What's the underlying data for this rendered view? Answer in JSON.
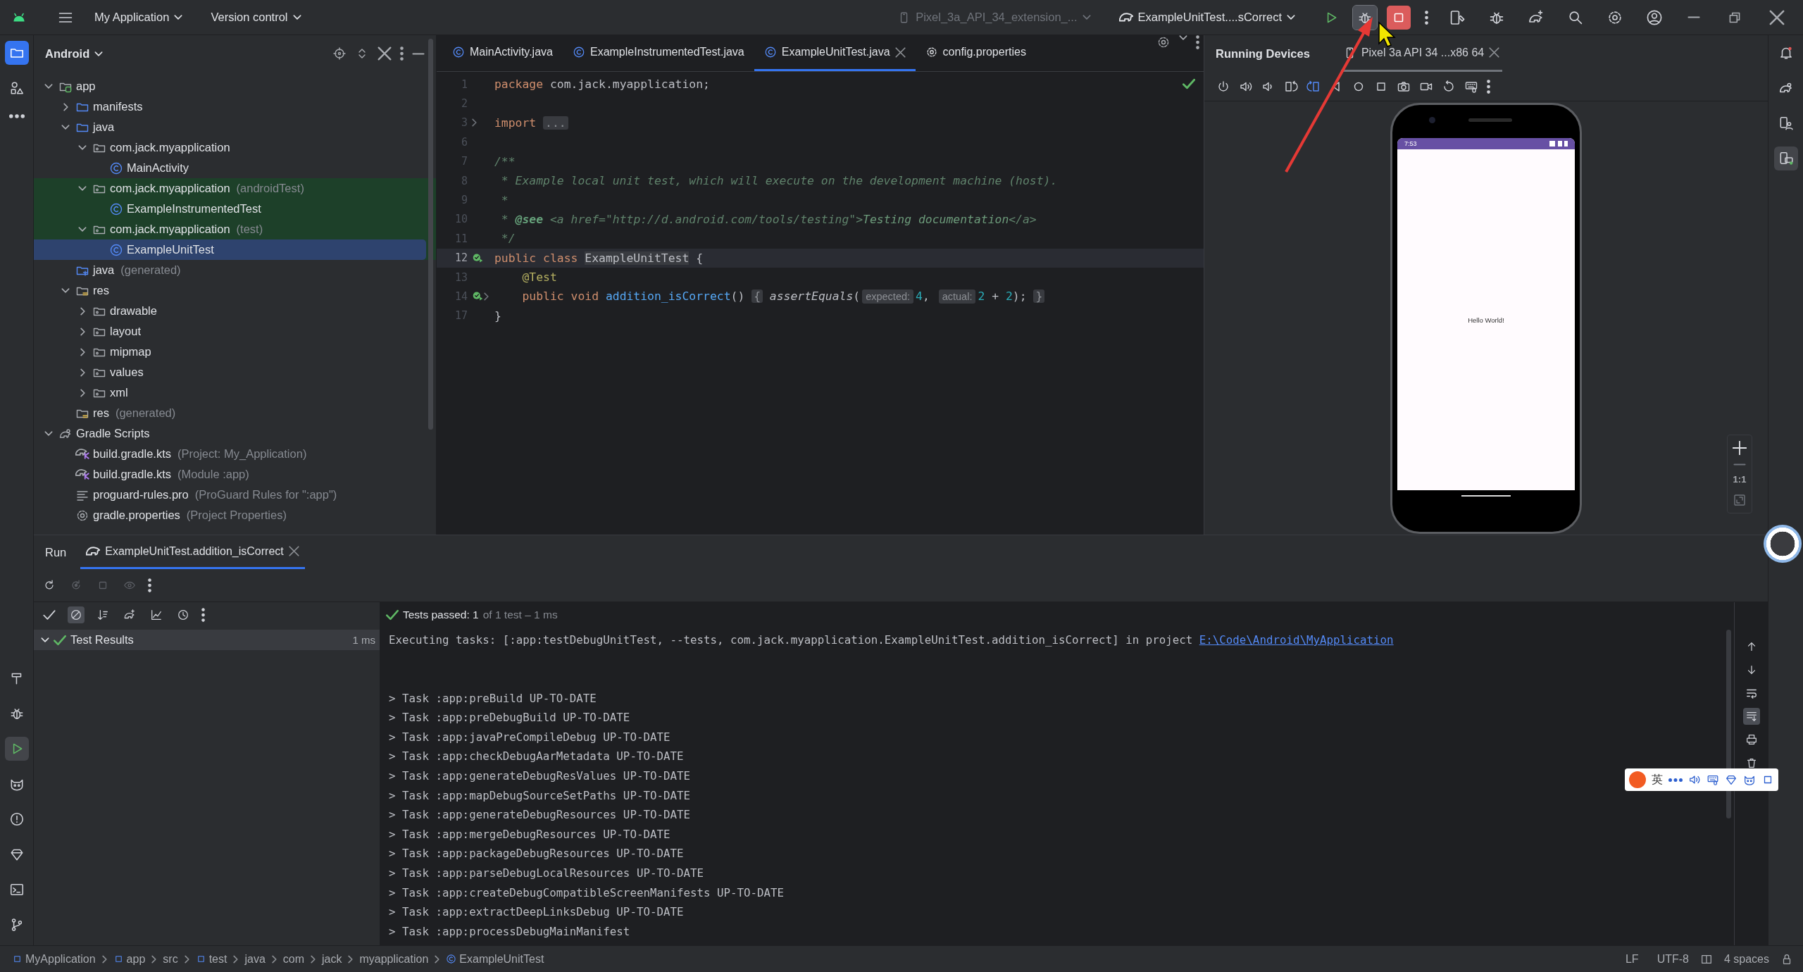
{
  "title_bar": {
    "menus": [
      {
        "label": "My Application"
      },
      {
        "label": "Version control"
      }
    ],
    "device": {
      "label": "Pixel_3a_API_34_extension_...",
      "disabled": true
    },
    "run_config": "ExampleUnitTest....sCorrect",
    "actions": [
      {
        "kind": "run",
        "highlighted": false
      },
      {
        "kind": "debug",
        "highlighted": true
      },
      {
        "kind": "stop",
        "highlighted": false
      }
    ]
  },
  "left_toolbar": {
    "top": [
      {
        "kind": "project",
        "selected": true
      },
      {
        "kind": "resources",
        "selected": false
      },
      {
        "kind": "more",
        "selected": false
      }
    ],
    "bottom": [
      {
        "kind": "build",
        "selected": false
      },
      {
        "kind": "debug",
        "selected": false
      },
      {
        "kind": "run",
        "selected": true
      },
      {
        "kind": "insights",
        "selected": false
      },
      {
        "kind": "problems",
        "selected": false
      },
      {
        "kind": "gem",
        "selected": false
      },
      {
        "kind": "terminal",
        "selected": false
      },
      {
        "kind": "git",
        "selected": false
      }
    ]
  },
  "right_toolbar": [
    {
      "kind": "notifications",
      "selected": false
    },
    {
      "kind": "gradle",
      "selected": false
    },
    {
      "kind": "device_manager",
      "selected": false
    },
    {
      "kind": "running_devices",
      "selected": true
    }
  ],
  "project_panel": {
    "title": "Android",
    "tree": [
      {
        "label": "app",
        "kind": "module",
        "expanded": true,
        "selected": false,
        "tinted": false,
        "children": [
          {
            "label": "manifests",
            "kind": "source",
            "expanded": false,
            "selected": false,
            "tinted": false
          },
          {
            "label": "java",
            "kind": "source",
            "expanded": true,
            "selected": false,
            "tinted": false,
            "children": [
              {
                "label": "com.jack.myapplication",
                "kind": "package",
                "expanded": true,
                "selected": false,
                "tinted": false,
                "children": [
                  {
                    "label": "MainActivity",
                    "kind": "class",
                    "selected": false,
                    "tinted": false
                  }
                ]
              },
              {
                "label": "com.jack.myapplication",
                "note": "(androidTest)",
                "kind": "package",
                "expanded": true,
                "selected": false,
                "tinted": true,
                "children": [
                  {
                    "label": "ExampleInstrumentedTest",
                    "kind": "class",
                    "selected": false,
                    "tinted": true
                  }
                ]
              },
              {
                "label": "com.jack.myapplication",
                "note": "(test)",
                "kind": "package",
                "expanded": true,
                "selected": false,
                "tinted": true,
                "children": [
                  {
                    "label": "ExampleUnitTest",
                    "kind": "class",
                    "selected": true,
                    "tinted": true
                  }
                ]
              }
            ]
          },
          {
            "label": "java",
            "note": "(generated)",
            "kind": "generated",
            "selected": false,
            "tinted": false
          },
          {
            "label": "res",
            "kind": "res",
            "expanded": true,
            "selected": false,
            "tinted": false,
            "children": [
              {
                "label": "drawable",
                "kind": "package",
                "expanded": false,
                "selected": false,
                "tinted": false
              },
              {
                "label": "layout",
                "kind": "package",
                "expanded": false,
                "selected": false,
                "tinted": false
              },
              {
                "label": "mipmap",
                "kind": "package",
                "expanded": false,
                "selected": false,
                "tinted": false
              },
              {
                "label": "values",
                "kind": "package",
                "expanded": false,
                "selected": false,
                "tinted": false
              },
              {
                "label": "xml",
                "kind": "package",
                "expanded": false,
                "selected": false,
                "tinted": false
              }
            ]
          },
          {
            "label": "res",
            "note": "(generated)",
            "kind": "res",
            "selected": false,
            "tinted": false
          }
        ]
      },
      {
        "label": "Gradle Scripts",
        "kind": "gradle",
        "expanded": true,
        "selected": false,
        "tinted": false,
        "children": [
          {
            "label": "build.gradle.kts",
            "note": "(Project: My_Application)",
            "kind": "gradle_kts",
            "selected": false,
            "tinted": false
          },
          {
            "label": "build.gradle.kts",
            "note": "(Module :app)",
            "kind": "gradle_kts",
            "selected": false,
            "tinted": false
          },
          {
            "label": "proguard-rules.pro",
            "note": "(ProGuard Rules for \":app\")",
            "kind": "text",
            "selected": false,
            "tinted": false
          },
          {
            "label": "gradle.properties",
            "note": "(Project Properties)",
            "kind": "settings",
            "selected": false,
            "tinted": false
          }
        ]
      }
    ]
  },
  "editor": {
    "tabs": [
      {
        "label": "MainActivity.java",
        "kind": "class",
        "selected": false
      },
      {
        "label": "ExampleInstrumentedTest.java",
        "kind": "class",
        "selected": false
      },
      {
        "label": "ExampleUnitTest.java",
        "kind": "class",
        "selected": true
      },
      {
        "label": "config.properties",
        "kind": "settings",
        "selected": false
      }
    ],
    "lines": [
      {
        "number": "1",
        "current": false,
        "run_marker": false,
        "foldable": false,
        "tokens": [
          {
            "kind": "keyword",
            "text": "package"
          },
          {
            "kind": "plain",
            "text": " com.jack.myapplication;"
          }
        ]
      },
      {
        "number": "2",
        "current": false,
        "run_marker": false,
        "foldable": false
      },
      {
        "number": "3",
        "current": false,
        "run_marker": false,
        "foldable": true,
        "tokens": [
          {
            "kind": "keyword",
            "text": "import "
          },
          {
            "kind": "fold",
            "text": "..."
          }
        ]
      },
      {
        "number": "6",
        "current": false,
        "run_marker": false,
        "foldable": false
      },
      {
        "number": "7",
        "current": false,
        "run_marker": false,
        "foldable": false,
        "tokens": [
          {
            "kind": "doc",
            "text": "/**"
          }
        ]
      },
      {
        "number": "8",
        "current": false,
        "run_marker": false,
        "foldable": false,
        "tokens": [
          {
            "kind": "doc",
            "text": " * Example local unit test, which will execute on the development machine (host)."
          }
        ]
      },
      {
        "number": "9",
        "current": false,
        "run_marker": false,
        "foldable": false,
        "tokens": [
          {
            "kind": "doc",
            "text": " *"
          }
        ]
      },
      {
        "number": "10",
        "current": false,
        "run_marker": false,
        "foldable": false,
        "tokens": [
          {
            "kind": "doc",
            "text": " * "
          },
          {
            "kind": "doc_tag",
            "text": "@see"
          },
          {
            "kind": "doc",
            "text": " <a href=\"http://d.android.com/tools/testing\">"
          },
          {
            "kind": "doc_link",
            "text": "Testing documentation"
          },
          {
            "kind": "doc",
            "text": "</a>"
          }
        ]
      },
      {
        "number": "11",
        "current": false,
        "run_marker": false,
        "foldable": false,
        "tokens": [
          {
            "kind": "doc",
            "text": " */"
          }
        ]
      },
      {
        "number": "12",
        "current": true,
        "run_marker": true,
        "foldable": false,
        "tokens": [
          {
            "kind": "keyword",
            "text": "public class "
          },
          {
            "kind": "highlight",
            "text": "ExampleUnitTest"
          },
          {
            "kind": "plain",
            "text": " {"
          }
        ]
      },
      {
        "number": "13",
        "current": false,
        "run_marker": false,
        "foldable": false,
        "tokens": [
          {
            "kind": "annotation",
            "text": "    @Test"
          }
        ]
      },
      {
        "number": "14",
        "current": false,
        "run_marker": true,
        "foldable": true,
        "tokens": [
          {
            "kind": "keyword",
            "text": "    public void "
          },
          {
            "kind": "function",
            "text": "addition_isCorrect"
          },
          {
            "kind": "plain",
            "text": "() "
          },
          {
            "kind": "fold",
            "text": "{"
          },
          {
            "kind": "call",
            "text": " assertEquals"
          },
          {
            "kind": "plain",
            "text": "("
          },
          {
            "kind": "hint",
            "text": "expected:"
          },
          {
            "kind": "number",
            "text": "4"
          },
          {
            "kind": "plain",
            "text": ", "
          },
          {
            "kind": "hint",
            "text": "actual:"
          },
          {
            "kind": "number",
            "text": "2"
          },
          {
            "kind": "plain",
            "text": " + "
          },
          {
            "kind": "number",
            "text": "2"
          },
          {
            "kind": "plain",
            "text": "); "
          },
          {
            "kind": "fold",
            "text": "}"
          }
        ]
      },
      {
        "number": "17",
        "current": false,
        "run_marker": false,
        "foldable": false,
        "tokens": [
          {
            "kind": "plain",
            "text": "}"
          }
        ]
      }
    ]
  },
  "device_panel": {
    "title": "Running Devices",
    "tabs": [
      {
        "label": "Pixel 3a API 34 ...x86 64",
        "selected": true
      }
    ],
    "screen": {
      "time": "7:53",
      "text": "Hello World!"
    },
    "zoom": {
      "actual_size": "1:1"
    }
  },
  "run_panel": {
    "title": "Run",
    "tabs": [
      {
        "label": "ExampleUnitTest.addition_isCorrect",
        "selected": true
      }
    ],
    "filters": [
      {
        "kind": "passed",
        "on": false
      },
      {
        "kind": "ignored",
        "on": true
      }
    ],
    "status": "Tests passed: 1",
    "summary": "of 1 test – 1 ms",
    "results": [
      {
        "label": "Test Results",
        "time": "1 ms",
        "passed": true,
        "expanded": true,
        "selected": true
      }
    ],
    "command": {
      "text": "Executing tasks: [:app:testDebugUnitTest, --tests, com.jack.myapplication.ExampleUnitTest.addition_isCorrect] in project ",
      "link": "E:\\Code\\Android\\MyApplication"
    },
    "output": [
      "> Task :app:preBuild UP-TO-DATE",
      "> Task :app:preDebugBuild UP-TO-DATE",
      "> Task :app:javaPreCompileDebug UP-TO-DATE",
      "> Task :app:checkDebugAarMetadata UP-TO-DATE",
      "> Task :app:generateDebugResValues UP-TO-DATE",
      "> Task :app:mapDebugSourceSetPaths UP-TO-DATE",
      "> Task :app:generateDebugResources UP-TO-DATE",
      "> Task :app:mergeDebugResources UP-TO-DATE",
      "> Task :app:packageDebugResources UP-TO-DATE",
      "> Task :app:parseDebugLocalResources UP-TO-DATE",
      "> Task :app:createDebugCompatibleScreenManifests UP-TO-DATE",
      "> Task :app:extractDeepLinksDebug UP-TO-DATE",
      "> Task :app:processDebugMainManifest"
    ]
  },
  "status_bar": {
    "breadcrumbs": [
      {
        "label": "MyApplication",
        "kind": "module"
      },
      {
        "label": "app",
        "kind": "module"
      },
      {
        "label": "src",
        "kind": "folder"
      },
      {
        "label": "test",
        "kind": "module"
      },
      {
        "label": "java",
        "kind": "folder"
      },
      {
        "label": "com",
        "kind": "folder"
      },
      {
        "label": "jack",
        "kind": "folder"
      },
      {
        "label": "myapplication",
        "kind": "folder"
      },
      {
        "label": "ExampleUnitTest",
        "kind": "class"
      }
    ],
    "line_separator": "LF",
    "encoding": "UTF-8",
    "indent": "4 spaces"
  },
  "ime_bar": {
    "mode": "英"
  }
}
